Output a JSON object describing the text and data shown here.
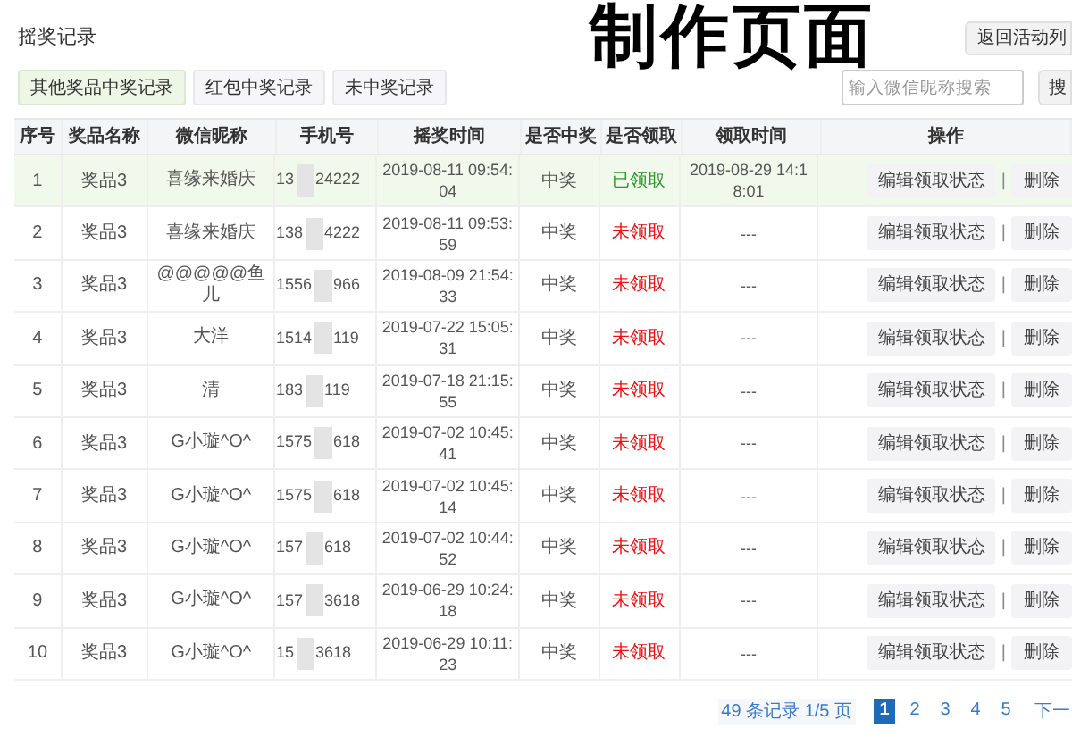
{
  "page_title": "摇奖记录",
  "overlay_caption": "制作页面",
  "back_button": "返回活动列",
  "tabs": [
    {
      "label": "其他奖品中奖记录",
      "selected": true
    },
    {
      "label": "红包中奖记录",
      "selected": false
    },
    {
      "label": "未中奖记录",
      "selected": false
    }
  ],
  "search": {
    "placeholder": "输入微信昵称搜索",
    "button": "搜"
  },
  "table": {
    "columns": [
      "序号",
      "奖品名称",
      "微信昵称",
      "手机号",
      "摇奖时间",
      "是否中奖",
      "是否领取",
      "领取时间",
      "操作"
    ],
    "rows": [
      {
        "no": "1",
        "prize": "奖品3",
        "nickname": "喜缘来婚庆",
        "phone_start": "13",
        "phone_end": "24222",
        "draw_time": "2019-08-11 09:54:04",
        "won": "中奖",
        "claimed": true,
        "claim_status": "已领取",
        "claim_time": "2019-08-29 14:18:01",
        "edit": "编辑领取状态",
        "separator": "|",
        "delete": "删除",
        "selected": true
      },
      {
        "no": "2",
        "prize": "奖品3",
        "nickname": "喜缘来婚庆",
        "phone_start": "138",
        "phone_end": "4222",
        "draw_time": "2019-08-11 09:53:59",
        "won": "中奖",
        "claimed": false,
        "claim_status": "未领取",
        "claim_time": "---",
        "edit": "编辑领取状态",
        "separator": "|",
        "delete": "删除",
        "selected": false
      },
      {
        "no": "3",
        "prize": "奖品3",
        "nickname": "@@@@@鱼儿",
        "phone_start": "1556",
        "phone_end": "966",
        "draw_time": "2019-08-09 21:54:33",
        "won": "中奖",
        "claimed": false,
        "claim_status": "未领取",
        "claim_time": "---",
        "edit": "编辑领取状态",
        "separator": "|",
        "delete": "删除",
        "selected": false
      },
      {
        "no": "4",
        "prize": "奖品3",
        "nickname": "大洋",
        "phone_start": "1514",
        "phone_end": "119",
        "draw_time": "2019-07-22 15:05:31",
        "won": "中奖",
        "claimed": false,
        "claim_status": "未领取",
        "claim_time": "---",
        "edit": "编辑领取状态",
        "separator": "|",
        "delete": "删除",
        "selected": false
      },
      {
        "no": "5",
        "prize": "奖品3",
        "nickname": "清",
        "phone_start": "183",
        "phone_end": "119",
        "draw_time": "2019-07-18 21:15:55",
        "won": "中奖",
        "claimed": false,
        "claim_status": "未领取",
        "claim_time": "---",
        "edit": "编辑领取状态",
        "separator": "|",
        "delete": "删除",
        "selected": false
      },
      {
        "no": "6",
        "prize": "奖品3",
        "nickname": "G小璇^O^",
        "phone_start": "1575",
        "phone_end": "618",
        "draw_time": "2019-07-02 10:45:41",
        "won": "中奖",
        "claimed": false,
        "claim_status": "未领取",
        "claim_time": "---",
        "edit": "编辑领取状态",
        "separator": "|",
        "delete": "删除",
        "selected": false
      },
      {
        "no": "7",
        "prize": "奖品3",
        "nickname": "G小璇^O^",
        "phone_start": "1575",
        "phone_end": "618",
        "draw_time": "2019-07-02 10:45:14",
        "won": "中奖",
        "claimed": false,
        "claim_status": "未领取",
        "claim_time": "---",
        "edit": "编辑领取状态",
        "separator": "|",
        "delete": "删除",
        "selected": false
      },
      {
        "no": "8",
        "prize": "奖品3",
        "nickname": "G小璇^O^",
        "phone_start": "157",
        "phone_end": "618",
        "draw_time": "2019-07-02 10:44:52",
        "won": "中奖",
        "claimed": false,
        "claim_status": "未领取",
        "claim_time": "---",
        "edit": "编辑领取状态",
        "separator": "|",
        "delete": "删除",
        "selected": false
      },
      {
        "no": "9",
        "prize": "奖品3",
        "nickname": "G小璇^O^",
        "phone_start": "157",
        "phone_end": "3618",
        "draw_time": "2019-06-29 10:24:18",
        "won": "中奖",
        "claimed": false,
        "claim_status": "未领取",
        "claim_time": "---",
        "edit": "编辑领取状态",
        "separator": "|",
        "delete": "删除",
        "selected": false
      },
      {
        "no": "10",
        "prize": "奖品3",
        "nickname": "G小璇^O^",
        "phone_start": "15",
        "phone_end": "3618",
        "draw_time": "2019-06-29 10:11:23",
        "won": "中奖",
        "claimed": false,
        "claim_status": "未领取",
        "claim_time": "---",
        "edit": "编辑领取状态",
        "separator": "|",
        "delete": "删除",
        "selected": false
      }
    ]
  },
  "pagination": {
    "summary": "49 条记录 1/5 页",
    "pages": [
      {
        "label": "1",
        "selected": true
      },
      {
        "label": "2",
        "selected": false
      },
      {
        "label": "3",
        "selected": false
      },
      {
        "label": "4",
        "selected": false
      },
      {
        "label": "5",
        "selected": false
      }
    ],
    "next": "下一"
  }
}
